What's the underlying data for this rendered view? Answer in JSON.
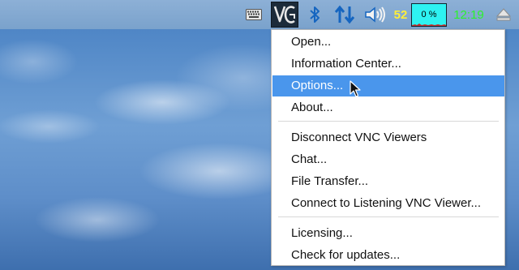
{
  "taskbar": {
    "icons": [
      "keyboard-icon",
      "vnc-icon",
      "bluetooth-icon",
      "network-icon",
      "volume-icon",
      "eject-icon"
    ],
    "cpu_temp": "52",
    "cpu_usage": "0 %",
    "clock": "12:19",
    "colors": {
      "panel": "#7ea6cf",
      "temp": "#ffef3a",
      "cpu_box": "#2ef2f2",
      "clock": "#2bf32b",
      "bluetooth": "#1565c0"
    }
  },
  "menu": {
    "highlight_color": "#4a96ec",
    "items": [
      {
        "label": "Open..."
      },
      {
        "label": "Information Center..."
      },
      {
        "label": "Options..."
      },
      {
        "label": "About..."
      },
      {
        "label": "Disconnect VNC Viewers"
      },
      {
        "label": "Chat..."
      },
      {
        "label": "File Transfer..."
      },
      {
        "label": "Connect to Listening VNC Viewer..."
      },
      {
        "label": "Licensing..."
      },
      {
        "label": "Check for updates..."
      }
    ],
    "active_item": "Options..."
  }
}
